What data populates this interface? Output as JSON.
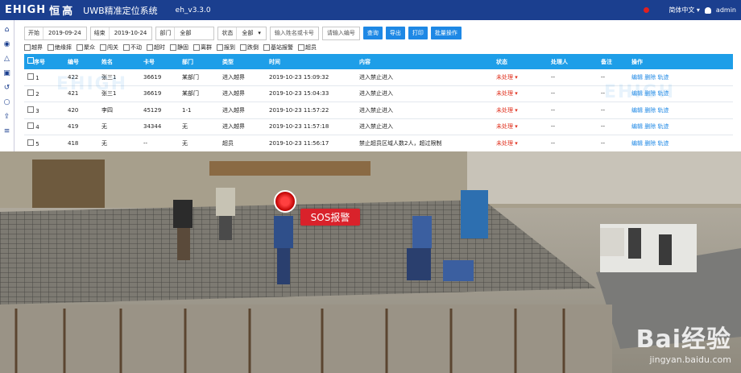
{
  "header": {
    "logo_en": "EHIGH",
    "logo_cn": "恒高",
    "app_title": "UWB精准定位系统",
    "version": "eh_v3.3.0",
    "language": "简体中文",
    "user": "admin"
  },
  "sidebar": {
    "items": [
      "home-icon",
      "eye-icon",
      "alert-icon",
      "video-icon",
      "history-icon",
      "circle-icon",
      "export-icon",
      "list-icon"
    ]
  },
  "filters": {
    "start_label": "开始",
    "start_value": "2019-09-24",
    "end_label": "结束",
    "end_value": "2019-10-24",
    "dept_label": "部门",
    "dept_value": "全部",
    "status_label": "状态",
    "status_value": "全部",
    "name_placeholder": "输入姓名或卡号",
    "id_placeholder": "请输入编号",
    "buttons": [
      "查询",
      "导出",
      "打印",
      "批量操作"
    ]
  },
  "checkboxes": [
    "越界",
    "绝缘摔",
    "聚众",
    "闯关",
    "不动",
    "超时",
    "静固",
    "离群",
    "报到",
    "跌倒",
    "基站报警",
    "超员"
  ],
  "table": {
    "headers": [
      "序号",
      "编号",
      "姓名",
      "卡号",
      "部门",
      "类型",
      "时间",
      "内容",
      "状态",
      "处理人",
      "备注",
      "操作"
    ],
    "rows": [
      {
        "idx": "1",
        "id": "422",
        "name": "张三1",
        "card": "36619",
        "dept": "某部门",
        "type": "进入越界",
        "time": "2019-10-23 15:09:32",
        "content": "进入禁止进入",
        "status": "未处理",
        "handler": "--",
        "note": "--",
        "ops": [
          "编辑",
          "删除",
          "轨迹"
        ]
      },
      {
        "idx": "2",
        "id": "421",
        "name": "张三1",
        "card": "36619",
        "dept": "某部门",
        "type": "进入越界",
        "time": "2019-10-23 15:04:33",
        "content": "进入禁止进入",
        "status": "未处理",
        "handler": "--",
        "note": "--",
        "ops": [
          "编辑",
          "删除",
          "轨迹"
        ]
      },
      {
        "idx": "3",
        "id": "420",
        "name": "李四",
        "card": "45129",
        "dept": "1-1",
        "type": "进入越界",
        "time": "2019-10-23 11:57:22",
        "content": "进入禁止进入",
        "status": "未处理",
        "handler": "--",
        "note": "--",
        "ops": [
          "编辑",
          "删除",
          "轨迹"
        ]
      },
      {
        "idx": "4",
        "id": "419",
        "name": "无",
        "card": "34344",
        "dept": "无",
        "type": "进入越界",
        "time": "2019-10-23 11:57:18",
        "content": "进入禁止进入",
        "status": "未处理",
        "handler": "--",
        "note": "--",
        "ops": [
          "编辑",
          "删除",
          "轨迹"
        ]
      },
      {
        "idx": "5",
        "id": "418",
        "name": "无",
        "card": "--",
        "dept": "无",
        "type": "超员",
        "time": "2019-10-23 11:56:17",
        "content": "禁止超员区域人数2人，超过限制",
        "status": "未处理",
        "handler": "--",
        "note": "--",
        "ops": [
          "编辑",
          "删除",
          "轨迹"
        ]
      }
    ]
  },
  "photo": {
    "sos_text": "SOS报警",
    "watermark_main": "Bai经验",
    "watermark_url": "jingyan.baidu.com"
  },
  "colors": {
    "topbar": "#1b3f8f",
    "accent": "#1e88e5",
    "table_header": "#1e9ee8",
    "alert": "#d9222b"
  }
}
